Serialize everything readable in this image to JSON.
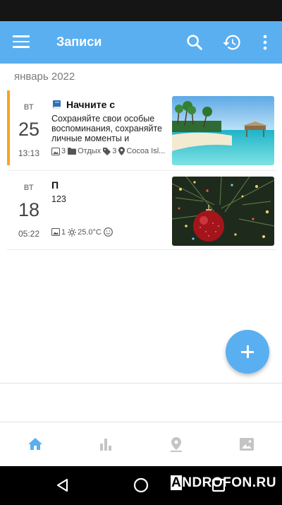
{
  "app_bar": {
    "title": "Записи",
    "background": "#5aaff0",
    "icons": [
      "menu-icon",
      "search-icon",
      "history-icon",
      "more-vert-icon"
    ]
  },
  "month_header": "январь 2022",
  "entries": [
    {
      "weekday": "ВТ",
      "day": "25",
      "time": "13:13",
      "title": "Начните с",
      "title_icon": "book-icon",
      "text": "Сохраняйте свои особые воспоминания, сохраняйте личные моменты и",
      "accent_color": "#f5a623",
      "meta": {
        "photos": "3",
        "category": "Отдых",
        "tags": "3",
        "location": "Cocoa Isl..."
      },
      "thumbnail": "beach-photo"
    },
    {
      "weekday": "ВТ",
      "day": "18",
      "time": "05:22",
      "title": "П",
      "text": "123",
      "meta": {
        "photos": "1",
        "weather": "25.0°C",
        "mood": "smile-icon"
      },
      "thumbnail": "christmas-ornament-photo"
    }
  ],
  "fab": {
    "icon": "plus-icon",
    "color": "#5aaff0"
  },
  "bottom_nav": {
    "items": [
      "home-icon",
      "stats-icon",
      "map-pin-icon",
      "gallery-icon"
    ],
    "active": "home-icon",
    "active_color": "#5aaff0",
    "inactive_color": "#c4c4c4"
  },
  "system_nav": {
    "buttons": [
      "back-icon",
      "home-circle-icon",
      "recents-icon"
    ]
  },
  "watermark": {
    "first": "A",
    "rest": "NDROFON.RU"
  }
}
